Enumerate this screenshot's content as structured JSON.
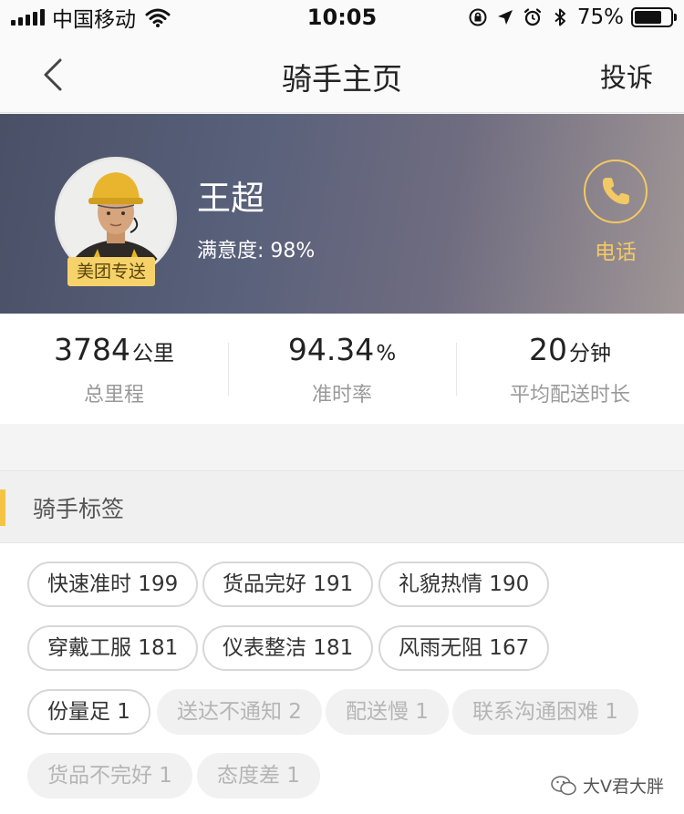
{
  "status_bar": {
    "carrier": "中国移动",
    "time": "10:05",
    "battery_pct": "75%",
    "battery_level": 0.75
  },
  "nav": {
    "title": "骑手主页",
    "right_label": "投诉"
  },
  "rider": {
    "name": "王超",
    "satisfaction": "满意度: 98%",
    "badge": "美团专送",
    "call_label": "电话"
  },
  "stats": [
    {
      "value": "3784",
      "unit": "公里",
      "label": "总里程"
    },
    {
      "value": "94.34",
      "unit": "%",
      "label": "准时率"
    },
    {
      "value": "20",
      "unit": "分钟",
      "label": "平均配送时长"
    }
  ],
  "section": {
    "title": "骑手标签"
  },
  "tags": [
    {
      "text": "快速准时 199",
      "negative": false
    },
    {
      "text": "货品完好 191",
      "negative": false
    },
    {
      "text": "礼貌热情 190",
      "negative": false
    },
    {
      "text": "穿戴工服 181",
      "negative": false
    },
    {
      "text": "仪表整洁 181",
      "negative": false
    },
    {
      "text": "风雨无阻 167",
      "negative": false
    },
    {
      "text": "份量足 1",
      "negative": false
    },
    {
      "text": "送达不通知 2",
      "negative": true
    },
    {
      "text": "配送慢 1",
      "negative": true
    },
    {
      "text": "联系沟通困难 1",
      "negative": true
    },
    {
      "text": "货品不完好 1",
      "negative": true
    },
    {
      "text": "态度差 1",
      "negative": true
    }
  ],
  "watermark": "大V君大胖",
  "colors": {
    "accent_gold": "#f2c964",
    "section_bar": "#f6c443",
    "badge_bg": "#f6d26a"
  }
}
